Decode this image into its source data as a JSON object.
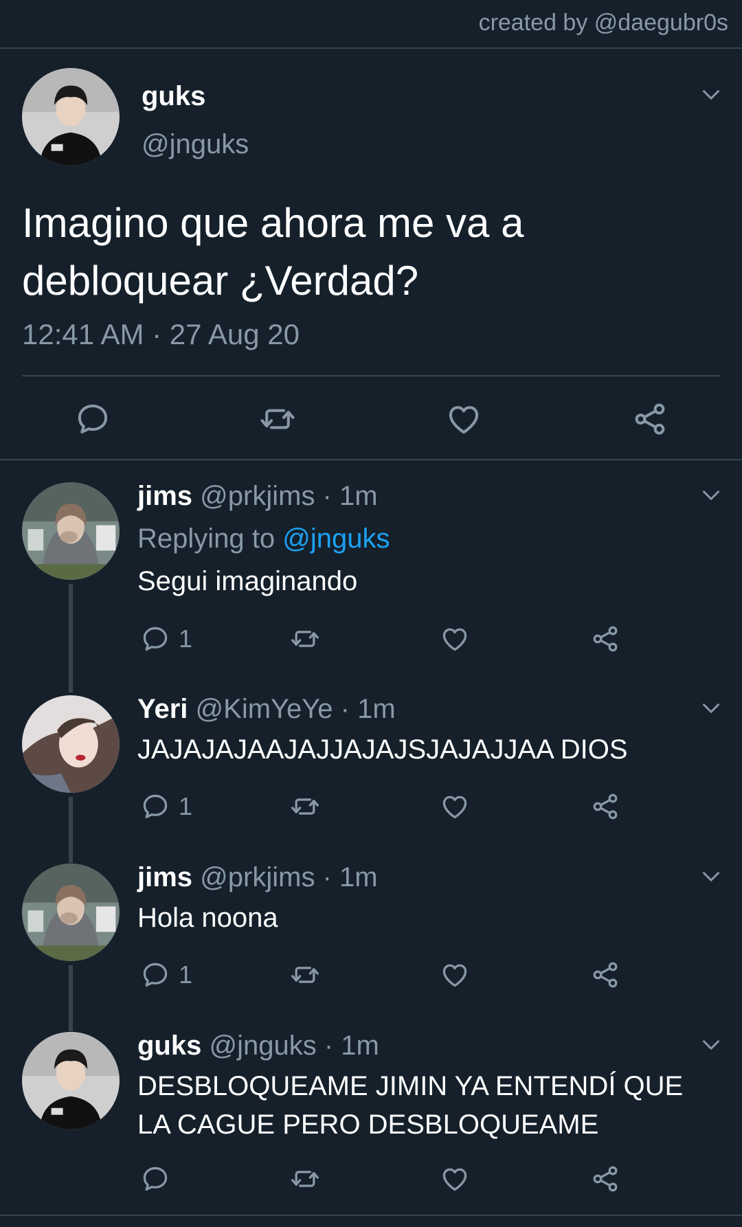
{
  "credit": "created by @daegubr0s",
  "main_tweet": {
    "display_name": "guks",
    "handle": "@jnguks",
    "text": "Imagino que ahora me va a debloquear ¿Verdad?",
    "timestamp": "12:41 AM · 27 Aug 20",
    "avatar_icon": "avatar-guks"
  },
  "replies": [
    {
      "display_name": "jims",
      "meta": "@prkjims · 1m",
      "replying_label": "Replying to",
      "replying_to": "@jnguks",
      "text": "Segui imaginando",
      "reply_count": "1"
    },
    {
      "display_name": "Yeri",
      "meta": "@KimYeYe · 1m",
      "text": "JAJAJAJAAJAJJAJAJSJAJAJJAA DIOS",
      "reply_count": "1"
    },
    {
      "display_name": "jims",
      "meta": "@prkjims · 1m",
      "text": "Hola noona",
      "reply_count": "1"
    },
    {
      "display_name": "guks",
      "meta": "@jnguks · 1m",
      "text": "DESBLOQUEAME JIMIN YA ENTENDÍ QUE LA CAGUE PERO DESBLOQUEAME",
      "reply_count": ""
    }
  ],
  "icons": [
    "reply-icon",
    "retweet-icon",
    "like-icon",
    "share-icon",
    "chevron-down-icon"
  ],
  "colors": {
    "background": "#15202b",
    "muted": "#8899a6",
    "accent": "#1da1f2",
    "divider": "#38444d"
  }
}
